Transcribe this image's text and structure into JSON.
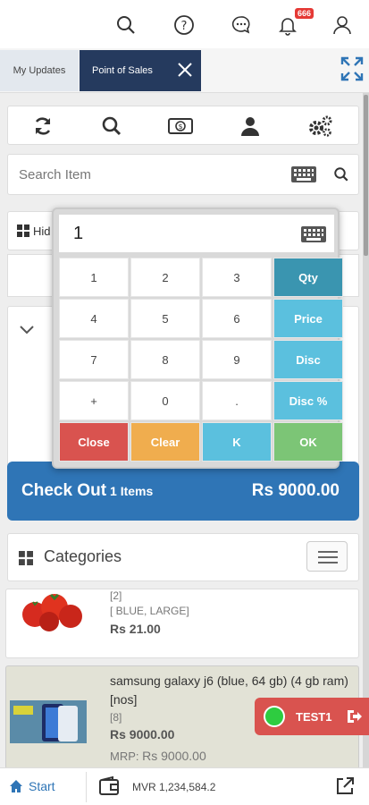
{
  "header": {
    "notifications_count": "666",
    "icons": [
      "search-icon",
      "help-icon",
      "chat-icon",
      "bell-icon",
      "user-icon"
    ]
  },
  "tabs": {
    "my_updates": "My Updates",
    "point_of_sales": "Point of Sales"
  },
  "search": {
    "placeholder": "Search Item"
  },
  "hidden_row": {
    "label": "Hid"
  },
  "numpad": {
    "display_value": "1",
    "keys": {
      "k1": "1",
      "k2": "2",
      "k3": "3",
      "qty": "Qty",
      "k4": "4",
      "k5": "5",
      "k6": "6",
      "price": "Price",
      "k7": "7",
      "k8": "8",
      "k9": "9",
      "disc": "Disc",
      "plus": "+",
      "k0": "0",
      "dot": ".",
      "disc_pct": "Disc %",
      "close": "Close",
      "clear": "Clear",
      "back": "K",
      "ok": "OK"
    }
  },
  "checkout": {
    "label": "Check Out",
    "items": "1 Items",
    "amount": "Rs 9000.00"
  },
  "categories": {
    "label": "Categories"
  },
  "products": [
    {
      "code": "[2]",
      "variant": "[ BLUE, LARGE]",
      "price": "Rs 21.00"
    },
    {
      "name": "samsung galaxy j6 (blue, 64 gb) (4 gb ram) [nos]",
      "code": "[8]",
      "price": "Rs 9000.00",
      "mrp_label": "MRP:",
      "mrp_value": "Rs 9000.00"
    }
  ],
  "test_widget": {
    "label": "TEST1"
  },
  "bottombar": {
    "start": "Start",
    "balance": "MVR 1,234,584.2"
  },
  "colors": {
    "primary": "#2f75b6",
    "danger": "#d9534f",
    "warning": "#f0ad4e",
    "info": "#5bc0de",
    "success": "#7cc576",
    "tab_active": "#253a5e"
  }
}
